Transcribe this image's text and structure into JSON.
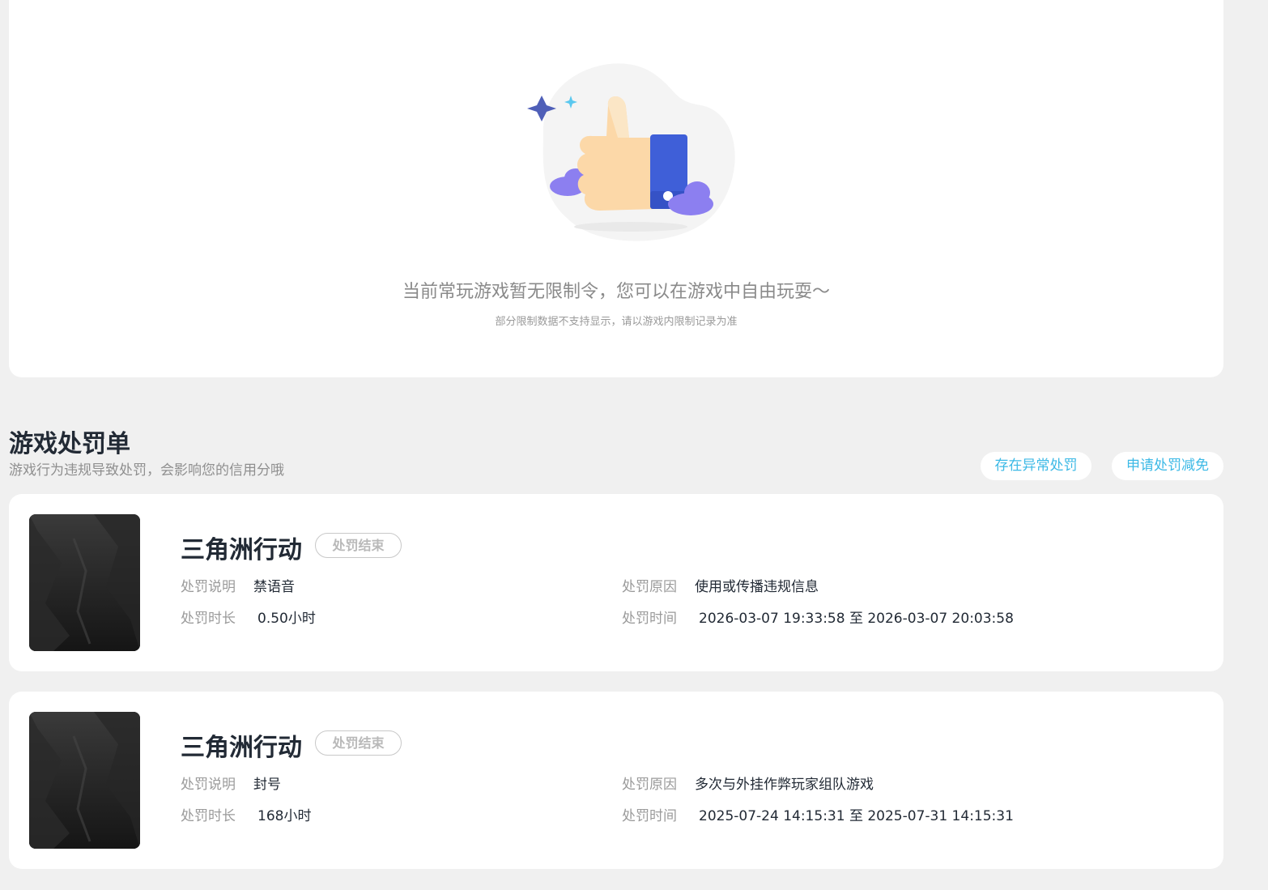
{
  "empty_state": {
    "title": "当前常玩游戏暂无限制令，您可以在游戏中自由玩耍～",
    "subtitle": "部分限制数据不支持显示，请以游戏内限制记录为准",
    "illustration_icon": "thumbs-up-illustration"
  },
  "penalties": {
    "title": "游戏处罚单",
    "description": "游戏行为违规导致处罚，会影响您的信用分哦",
    "actions": {
      "abnormal_label": "存在异常处罚",
      "reduce_label": "申请处罚减免"
    },
    "labels": {
      "desc": "处罚说明",
      "duration": "处罚时长",
      "reason": "处罚原因",
      "time": "处罚时间"
    },
    "records": [
      {
        "game": "三角洲行动",
        "status": "处罚结束",
        "desc": "禁语音",
        "duration": "0.50小时",
        "reason": "使用或传播违规信息",
        "time": "2026-03-07 19:33:58 至 2026-03-07 20:03:58"
      },
      {
        "game": "三角洲行动",
        "status": "处罚结束",
        "desc": "封号",
        "duration": "168小时",
        "reason": "多次与外挂作弊玩家组队游戏",
        "time": "2025-07-24 14:15:31 至 2025-07-31 14:15:31"
      }
    ]
  },
  "colors": {
    "accent": "#3cb9e6",
    "page_bg": "#f0f0f0",
    "card_bg": "#ffffff",
    "text_dark": "#222a35",
    "text_muted": "#9a9a9a"
  }
}
